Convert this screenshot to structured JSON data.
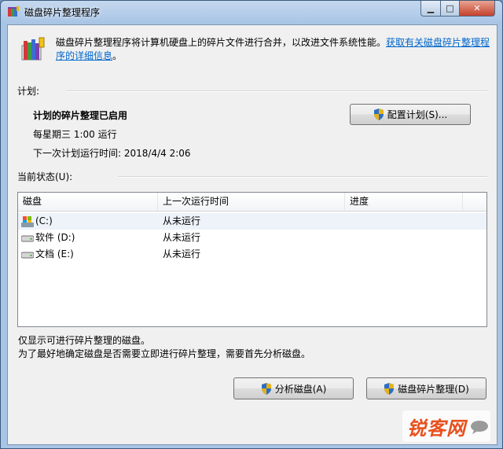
{
  "window": {
    "title": "磁盘碎片整理程序"
  },
  "header": {
    "description": "磁盘碎片整理程序将计算机硬盘上的碎片文件进行合并，以改进文件系统性能。",
    "link_line1": "获取有关磁盘碎片整理程",
    "link_line2": "序的详细信息",
    "link_suffix": "。"
  },
  "schedule": {
    "section_label": "计划:",
    "status": "计划的碎片整理已启用",
    "frequency": "每星期三  1:00 运行",
    "next_run": "下一次计划运行时间: 2018/4/4 2:06",
    "configure_button": "配置计划(S)..."
  },
  "current_status": {
    "section_label": "当前状态(U):",
    "columns": [
      "磁盘",
      "上一次运行时间",
      "进度"
    ],
    "rows": [
      {
        "disk": "(C:)",
        "last_run": "从未运行",
        "progress": ""
      },
      {
        "disk": "软件 (D:)",
        "last_run": "从未运行",
        "progress": ""
      },
      {
        "disk": "文档 (E:)",
        "last_run": "从未运行",
        "progress": ""
      }
    ]
  },
  "notes": {
    "line1": "仅显示可进行碎片整理的磁盘。",
    "line2": "为了最好地确定磁盘是否需要立即进行碎片整理，需要首先分析磁盘。"
  },
  "actions": {
    "analyze_button": "分析磁盘(A)",
    "defrag_button": "磁盘碎片整理(D)"
  },
  "watermark": {
    "text": "锐客网"
  },
  "colors": {
    "link": "#0066cc",
    "title_bar": "#a9c5e6",
    "close_button": "#c4402b"
  }
}
